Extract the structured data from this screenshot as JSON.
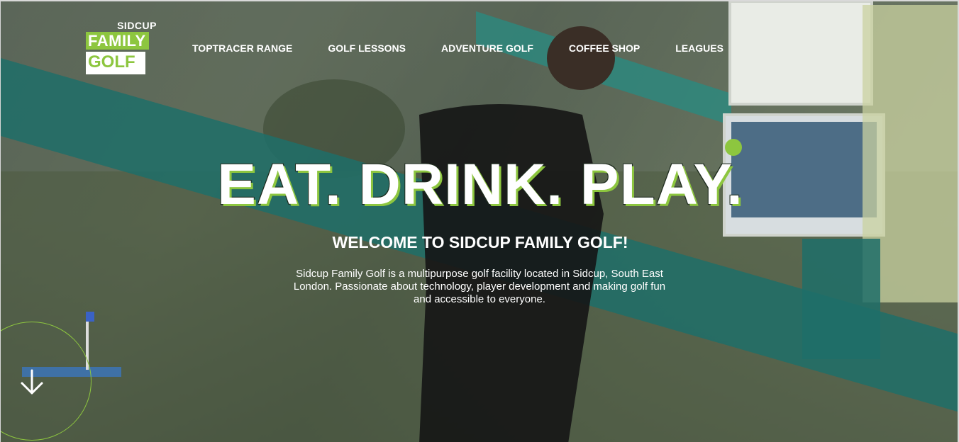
{
  "logo": {
    "top_text": "SIDCUP",
    "family_text": "FAMILY",
    "golf_text": "GOLF"
  },
  "nav": {
    "items": [
      {
        "label": "TOPTRACER RANGE"
      },
      {
        "label": "GOLF LESSONS"
      },
      {
        "label": "ADVENTURE GOLF"
      },
      {
        "label": "COFFEE SHOP"
      },
      {
        "label": "LEAGUES"
      }
    ]
  },
  "hero": {
    "headline": "EAT. DRINK. PLAY.",
    "subheading": "WELCOME TO SIDCUP FAMILY GOLF!",
    "intro": "Sidcup Family Golf is a multipurpose golf facility located in Sidcup, South East London. Passionate about technology, player development and making golf fun and accessible to everyone."
  },
  "icons": {
    "scroll_down": "arrow-down-icon"
  },
  "colors": {
    "accent": "#8dc63f",
    "text": "#ffffff"
  }
}
